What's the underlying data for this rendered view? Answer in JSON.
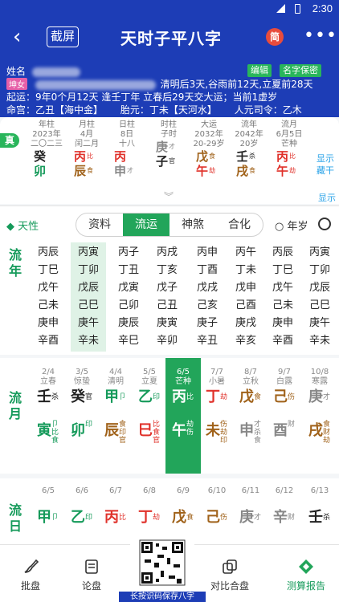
{
  "status": {
    "time": "2:30"
  },
  "header": {
    "back": "‹",
    "screenshot": "截屏",
    "title": "天时子平八字",
    "simplified": "简",
    "more": "•••"
  },
  "info": {
    "name_label": "姓名",
    "gender_tag": "坤女",
    "jieqi": "清明后3天,谷雨前12天,立夏前28天",
    "qiyun": "起运：9年0个月12天 逢壬丁年 立春后29天交大运；当前1虚岁",
    "mingong": "命宫：乙丑【海中金】",
    "taiyuan": "胎元：丁未【天河水】",
    "renyuan": "人元司令：乙木",
    "btn_edit": "编辑",
    "btn_save": "名字保密"
  },
  "pillars": {
    "zhen": "真",
    "cols": [
      {
        "h1": "年柱",
        "h2": "2023年",
        "h3": "二〇二三",
        "stem": "癸",
        "stem_ss": "",
        "branch": "卯",
        "branch_ss": ""
      },
      {
        "h1": "月柱",
        "h2": "4月",
        "h3": "闰二月",
        "stem": "丙",
        "stem_ss": "比",
        "branch": "辰",
        "branch_ss": "食"
      },
      {
        "h1": "日柱",
        "h2": "8日",
        "h3": "十八",
        "stem": "丙",
        "stem_ss": "",
        "branch": "申",
        "branch_ss": "才"
      },
      {
        "h1": "时柱",
        "h2": "",
        "h3": "子时",
        "stem": "庚",
        "stem_ss": "才",
        "branch": "子",
        "branch_ss": "官"
      },
      {
        "h1": "大运",
        "h2": "2032年",
        "h3": "20-29岁",
        "stem": "戊",
        "stem_ss": "食",
        "branch": "午",
        "branch_ss": "劫"
      },
      {
        "h1": "流年",
        "h2": "2042年",
        "h3": "20岁",
        "stem": "壬",
        "stem_ss": "杀",
        "branch": "戌",
        "branch_ss": "食"
      },
      {
        "h1": "流月",
        "h2": "6月5日",
        "h3": "芒种",
        "stem": "丙",
        "stem_ss": "比",
        "branch": "午",
        "branch_ss": "劫"
      }
    ],
    "show_hide": "显示藏干",
    "show": "显示"
  },
  "tabs": {
    "tianxing": "天性",
    "items": [
      "资料",
      "流运",
      "神煞",
      "合化"
    ],
    "active": 1,
    "nian_sui": "年岁"
  },
  "liunian": {
    "title": "流年",
    "cols": [
      [
        "丙辰",
        "丁巳",
        "戊午",
        "己未",
        "庚申",
        "辛酉"
      ],
      [
        "丙寅",
        "丁卯",
        "戊辰",
        "己巳",
        "庚午",
        "辛未"
      ],
      [
        "丙子",
        "丁丑",
        "戊寅",
        "己卯",
        "庚辰",
        "辛巳"
      ],
      [
        "丙戌",
        "丁亥",
        "戊子",
        "己丑",
        "庚寅",
        "辛卯"
      ],
      [
        "丙申",
        "丁酉",
        "戊戌",
        "己亥",
        "庚子",
        "辛丑"
      ],
      [
        "丙午",
        "丁未",
        "戊申",
        "己酉",
        "庚戌",
        "辛亥"
      ],
      [
        "丙辰",
        "丁巳",
        "戊午",
        "己未",
        "庚申",
        "辛酉"
      ],
      [
        "丙寅",
        "丁卯",
        "戊辰",
        "己巳",
        "庚午",
        "辛未"
      ]
    ]
  },
  "liuyue": {
    "title": "流月",
    "cols": [
      {
        "date": "2/4",
        "term": "立春",
        "stem": "壬",
        "stem_ss": "杀",
        "branch": "寅",
        "branch_ss": "卩比食"
      },
      {
        "date": "3/5",
        "term": "惊蛰",
        "stem": "癸",
        "stem_ss": "官",
        "branch": "卯",
        "branch_ss": "印"
      },
      {
        "date": "4/4",
        "term": "清明",
        "stem": "甲",
        "stem_ss": "卩",
        "branch": "辰",
        "branch_ss": "食印官"
      },
      {
        "date": "5/5",
        "term": "立夏",
        "stem": "乙",
        "stem_ss": "印",
        "branch": "巳",
        "branch_ss": "比食官"
      },
      {
        "date": "6/5",
        "term": "芒种",
        "stem": "丙",
        "stem_ss": "比",
        "branch": "午",
        "branch_ss": "劫伤"
      },
      {
        "date": "7/7",
        "term": "小暑",
        "stem": "丁",
        "stem_ss": "劫",
        "branch": "未",
        "branch_ss": "伤劫印"
      },
      {
        "date": "8/7",
        "term": "立秋",
        "stem": "戊",
        "stem_ss": "食",
        "branch": "申",
        "branch_ss": "才杀食"
      },
      {
        "date": "9/7",
        "term": "白露",
        "stem": "己",
        "stem_ss": "伤",
        "branch": "酉",
        "branch_ss": "财"
      },
      {
        "date": "10/8",
        "term": "寒露",
        "stem": "庚",
        "stem_ss": "才",
        "branch": "戌",
        "branch_ss": "食财劫"
      }
    ],
    "active": 4
  },
  "liuri": {
    "title": "流日",
    "cols": [
      {
        "date": "6/5",
        "stem": "甲",
        "ss": "卩"
      },
      {
        "date": "6/6",
        "stem": "乙",
        "ss": "印"
      },
      {
        "date": "6/7",
        "stem": "丙",
        "ss": "比"
      },
      {
        "date": "6/8",
        "stem": "丁",
        "ss": "劫"
      },
      {
        "date": "6/9",
        "stem": "戊",
        "ss": "食"
      },
      {
        "date": "6/10",
        "stem": "己",
        "ss": "伤"
      },
      {
        "date": "6/11",
        "stem": "庚",
        "ss": "才"
      },
      {
        "date": "6/12",
        "stem": "辛",
        "ss": "财"
      },
      {
        "date": "6/13",
        "stem": "壬",
        "ss": "杀"
      }
    ]
  },
  "bottom": {
    "items": [
      "批盘",
      "论盘",
      "对比合盘",
      "测算报告"
    ],
    "qr_caption": "长按识码保存八字"
  },
  "colors": {
    "brand": "#1d3db6",
    "green": "#22a55a",
    "wood": "#159a5a",
    "fire": "#e0312a",
    "earth": "#a0621a",
    "metal": "#888888",
    "water": "#222222"
  }
}
